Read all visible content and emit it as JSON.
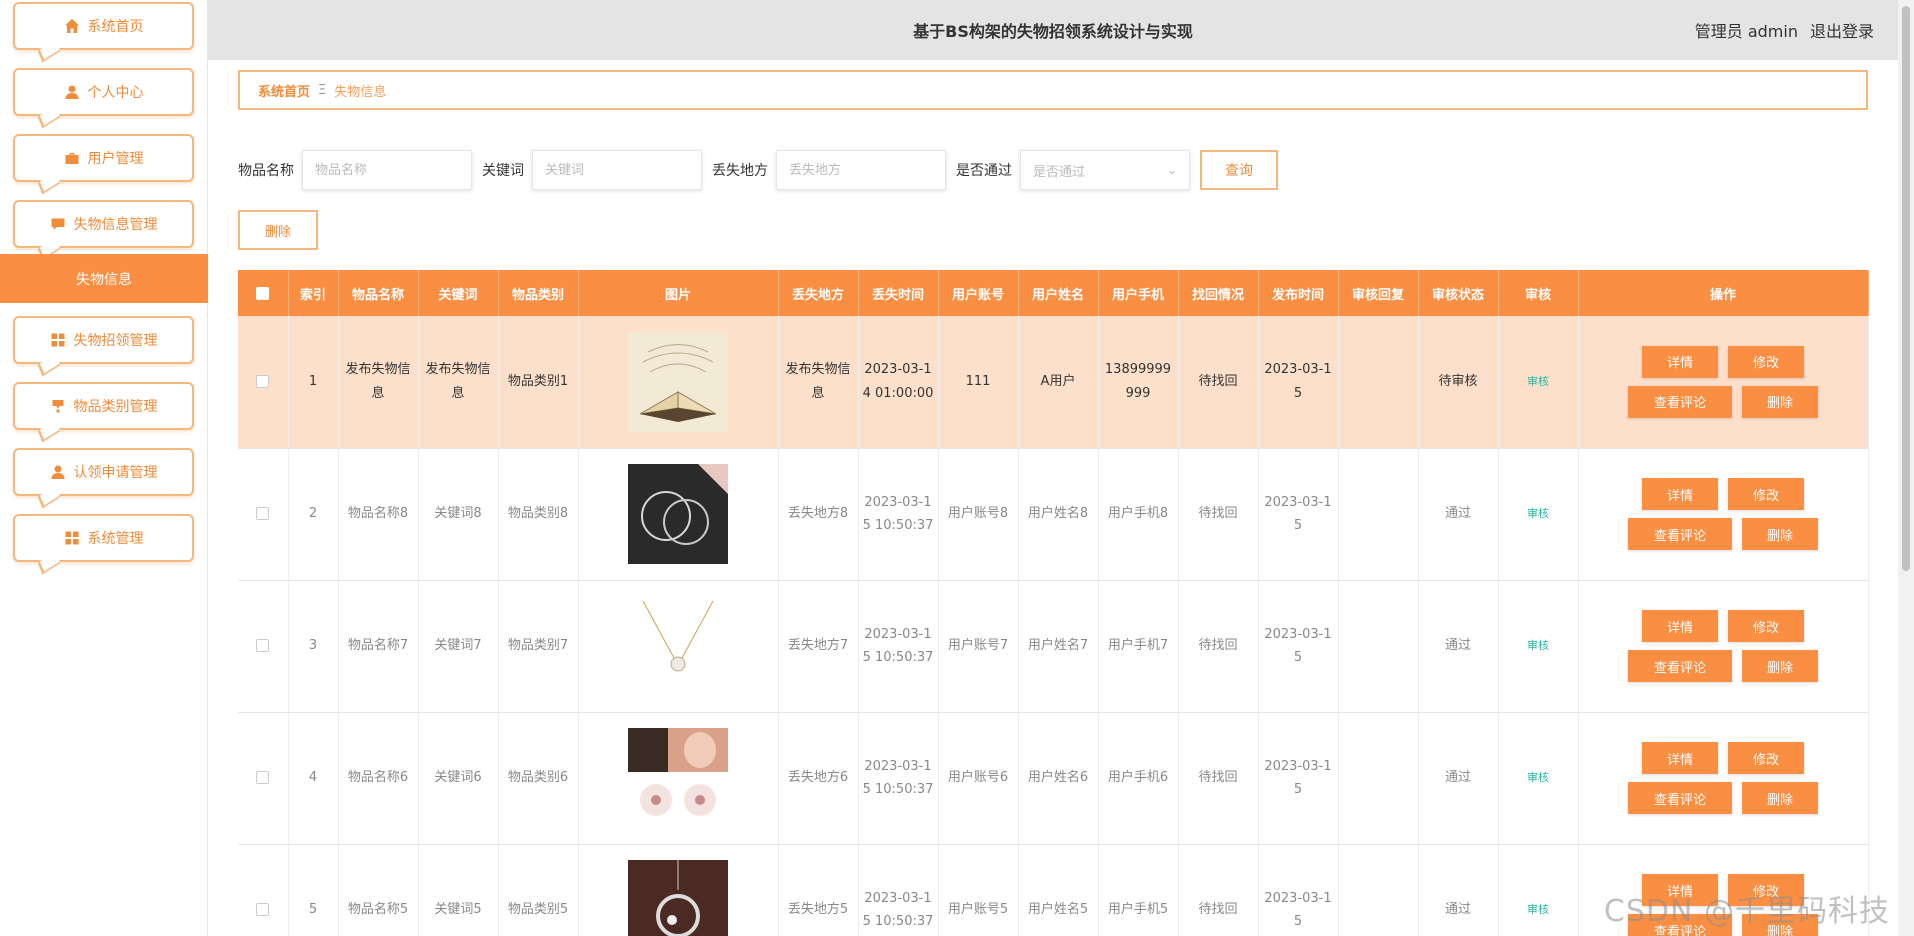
{
  "header": {
    "title": "基于BS构架的失物招领系统设计与实现",
    "user_label": "管理员 admin",
    "logout_label": "退出登录"
  },
  "sidebar": {
    "items": [
      {
        "label": "系统首页",
        "icon": "home-icon"
      },
      {
        "label": "个人中心",
        "icon": "user-icon"
      },
      {
        "label": "用户管理",
        "icon": "briefcase-icon"
      },
      {
        "label": "失物信息管理",
        "icon": "chat-icon"
      },
      {
        "label": "失物招领管理",
        "icon": "grid-icon"
      },
      {
        "label": "物品类别管理",
        "icon": "cup-icon"
      },
      {
        "label": "认领申请管理",
        "icon": "user-icon"
      },
      {
        "label": "系统管理",
        "icon": "grid-icon"
      }
    ],
    "active_sub": "失物信息"
  },
  "breadcrumb": {
    "home": "系统首页",
    "separator": "Ξ",
    "current": "失物信息"
  },
  "search": {
    "name_label": "物品名称",
    "name_placeholder": "物品名称",
    "keyword_label": "关键词",
    "keyword_placeholder": "关键词",
    "place_label": "丢失地方",
    "place_placeholder": "丢失地方",
    "pass_label": "是否通过",
    "pass_placeholder": "是否通过",
    "query_button": "查询",
    "delete_button": "删除"
  },
  "table": {
    "headers": [
      "索引",
      "物品名称",
      "关键词",
      "物品类别",
      "图片",
      "丢失地方",
      "丢失时间",
      "用户账号",
      "用户姓名",
      "用户手机",
      "找回情况",
      "发布时间",
      "审核回复",
      "审核状态",
      "审核",
      "操作"
    ],
    "audit_link": "审核",
    "actions": {
      "detail": "详情",
      "edit": "修改",
      "comments": "查看评论",
      "delete": "删除"
    },
    "rows": [
      {
        "index": "1",
        "name": "发布失物信息",
        "keyword": "发布失物信息",
        "category": "物品类别1",
        "place": "发布失物信息",
        "lost_time": "2023-03-14 01:00:00",
        "account": "111",
        "username": "A用户",
        "phone": "13899999999",
        "found": "待找回",
        "publish": "2023-03-15",
        "reply": "",
        "status": "待审核",
        "image": "book"
      },
      {
        "index": "2",
        "name": "物品名称8",
        "keyword": "关键词8",
        "category": "物品类别8",
        "place": "丢失地方8",
        "lost_time": "2023-03-15 10:50:37",
        "account": "用户账号8",
        "username": "用户姓名8",
        "phone": "用户手机8",
        "found": "待找回",
        "publish": "2023-03-15",
        "reply": "",
        "status": "通过",
        "image": "hoops"
      },
      {
        "index": "3",
        "name": "物品名称7",
        "keyword": "关键词7",
        "category": "物品类别7",
        "place": "丢失地方7",
        "lost_time": "2023-03-15 10:50:37",
        "account": "用户账号7",
        "username": "用户姓名7",
        "phone": "用户手机7",
        "found": "待找回",
        "publish": "2023-03-15",
        "reply": "",
        "status": "通过",
        "image": "necklace"
      },
      {
        "index": "4",
        "name": "物品名称6",
        "keyword": "关键词6",
        "category": "物品类别6",
        "place": "丢失地方6",
        "lost_time": "2023-03-15 10:50:37",
        "account": "用户账号6",
        "username": "用户姓名6",
        "phone": "用户手机6",
        "found": "待找回",
        "publish": "2023-03-15",
        "reply": "",
        "status": "通过",
        "image": "earrings"
      },
      {
        "index": "5",
        "name": "物品名称5",
        "keyword": "关键词5",
        "category": "物品类别5",
        "place": "丢失地方5",
        "lost_time": "2023-03-15 10:50:37",
        "account": "用户账号5",
        "username": "用户姓名5",
        "phone": "用户手机5",
        "found": "待找回",
        "publish": "2023-03-15",
        "reply": "",
        "status": "通过",
        "image": "pendant"
      }
    ]
  },
  "watermark": "CSDN @千里码科技",
  "colors": {
    "accent": "#fa8f43",
    "accent_light": "#fde0cb",
    "border": "#f5b77c",
    "audit": "#2bb59e"
  }
}
